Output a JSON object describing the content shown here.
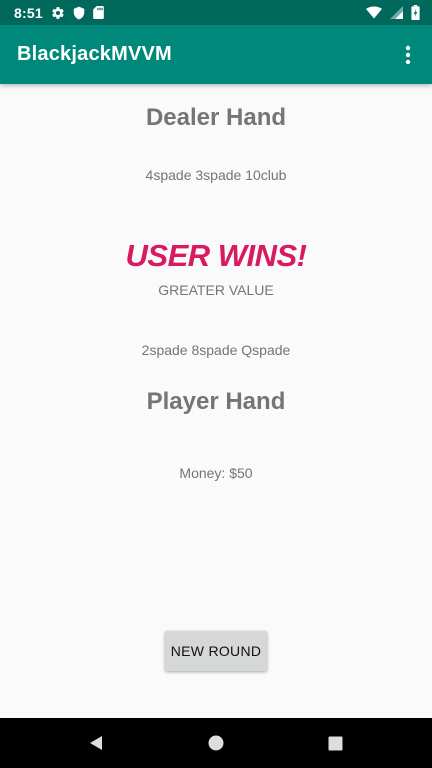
{
  "status_bar": {
    "time": "8:51",
    "left_icons": [
      "gear-icon",
      "shield-icon",
      "sd-card-icon"
    ],
    "right_icons": [
      "wifi-icon",
      "signal-icon",
      "battery-icon"
    ]
  },
  "app_bar": {
    "title": "BlackjackMVVM",
    "menu_icon": "more-vert-icon"
  },
  "dealer": {
    "title": "Dealer Hand",
    "cards": "4spade 3spade 10club"
  },
  "result": {
    "headline": "USER WINS!",
    "reason": "GREATER VALUE"
  },
  "player": {
    "cards": "2spade 8spade Qspade",
    "title": "Player Hand",
    "money": "Money: $50"
  },
  "actions": {
    "new_round_label": "NEW ROUND"
  },
  "nav_bar": {
    "icons": [
      "back-icon",
      "home-icon",
      "recents-icon"
    ]
  },
  "colors": {
    "status_bar": "#00695c",
    "app_bar": "#00897b",
    "result_text": "#d81b60",
    "muted_text": "#757575",
    "button_bg": "#d6d7d7"
  }
}
